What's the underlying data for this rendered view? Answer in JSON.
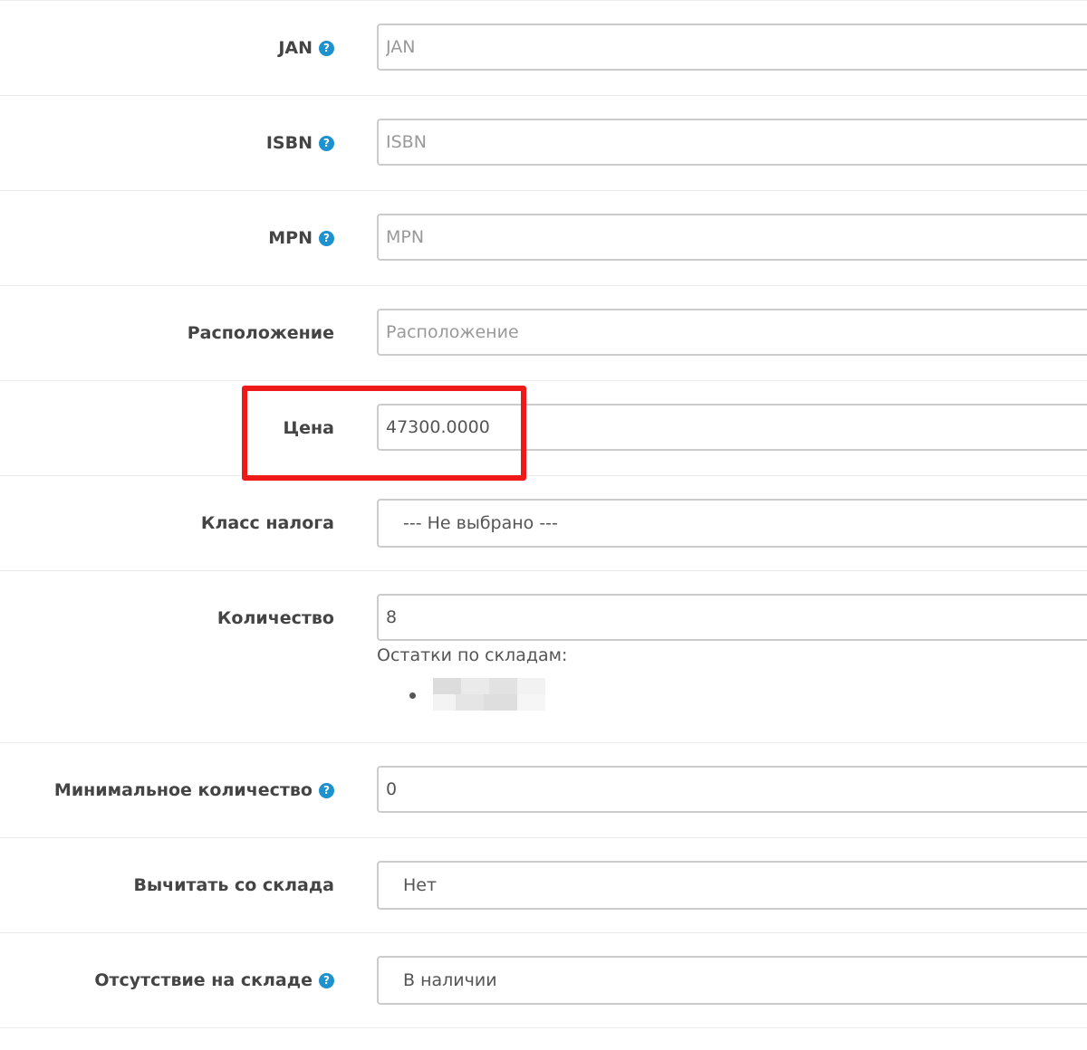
{
  "form": {
    "rows": [
      {
        "label": "JAN",
        "placeholder": "JAN",
        "value": ""
      },
      {
        "label": "ISBN",
        "placeholder": "ISBN",
        "value": ""
      },
      {
        "label": "MPN",
        "placeholder": "MPN",
        "value": ""
      },
      {
        "label": "Расположение",
        "placeholder": "Расположение",
        "value": ""
      },
      {
        "label": "Цена",
        "placeholder": "",
        "value": "47300.0000"
      },
      {
        "label": "Класс налога",
        "selected": "--- Не выбрано ---"
      },
      {
        "label": "Количество",
        "value": "8",
        "stock_title": "Остатки по складам:"
      },
      {
        "label": "Минимальное количество",
        "value": "0"
      },
      {
        "label": "Вычитать со склада",
        "selected": "Нет"
      },
      {
        "label": "Отсутствие на складе",
        "selected": "В наличии"
      }
    ],
    "help_glyph": "?",
    "help_color": "#1e91cf",
    "highlight_color": "#ee1a1a"
  }
}
